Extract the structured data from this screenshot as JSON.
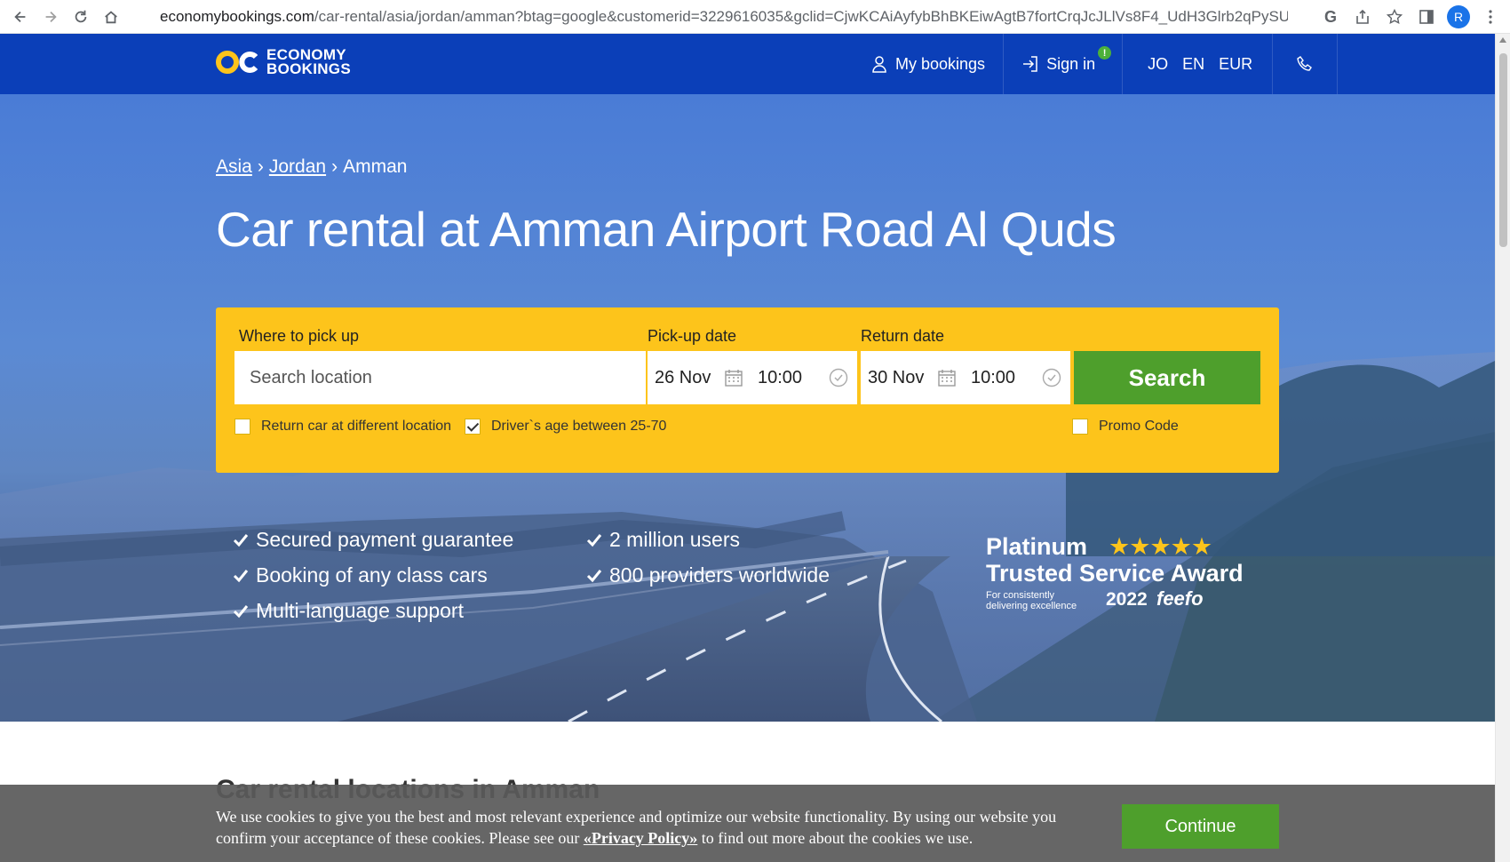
{
  "browser": {
    "url_host": "economybookings.com",
    "url_path": "/car-rental/asia/jordan/amman?btag=google&customerid=3229616035&gclid=CjwKCAiAyfybBhBKEiwAgtB7fortCrqJcJLlVs8F4_UdH3Glrb2qPySUlRRxWDaq55v_q...",
    "profile_initial": "R",
    "extension_letter": "G"
  },
  "header": {
    "logo_line1": "ECONOMY",
    "logo_line2": "BOOKINGS",
    "my_bookings": "My bookings",
    "sign_in": "Sign in",
    "sign_in_badge": "!",
    "country": "JO",
    "language": "EN",
    "currency": "EUR"
  },
  "breadcrumb": {
    "items": [
      "Asia",
      "Jordan"
    ],
    "separator": "›",
    "current": "Amman"
  },
  "page_title": "Car rental at Amman Airport Road Al Quds",
  "search_form": {
    "pickup_label": "Where to pick up",
    "pickup_placeholder": "Search location",
    "pickup_date_label": "Pick-up date",
    "pickup_date": "26 Nov",
    "pickup_time": "10:00",
    "return_date_label": "Return date",
    "return_date": "30 Nov",
    "return_time": "10:00",
    "search_button": "Search",
    "return_different_label": "Return car at different location",
    "return_different_checked": false,
    "driver_age_label": "Driver`s age between 25-70",
    "driver_age_checked": true,
    "promo_label": "Promo Code",
    "promo_checked": false
  },
  "features": [
    "Secured payment guarantee",
    "Booking of any class cars",
    "Multi-language support",
    "2 million users",
    "800 providers worldwide"
  ],
  "award": {
    "line1": "Platinum",
    "stars": "★★★★★",
    "line2": "Trusted Service Award",
    "line3": "For consistently delivering excellence",
    "year": "2022",
    "brand": "feefo"
  },
  "section_title": "Car rental locations in Amman",
  "cookie": {
    "text_before": "We use cookies to give you the best and most relevant experience and optimize our website functionality. By using our website you confirm your acceptance of these cookies. Please see our",
    "link": "«Privacy Policy»",
    "text_after": "to find out more about the cookies we use.",
    "continue_button": "Continue"
  },
  "colors": {
    "header_blue": "#0b3fb8",
    "search_yellow": "#fdc41b",
    "search_green": "#4e9f2c",
    "star_yellow": "#fdc41b"
  }
}
